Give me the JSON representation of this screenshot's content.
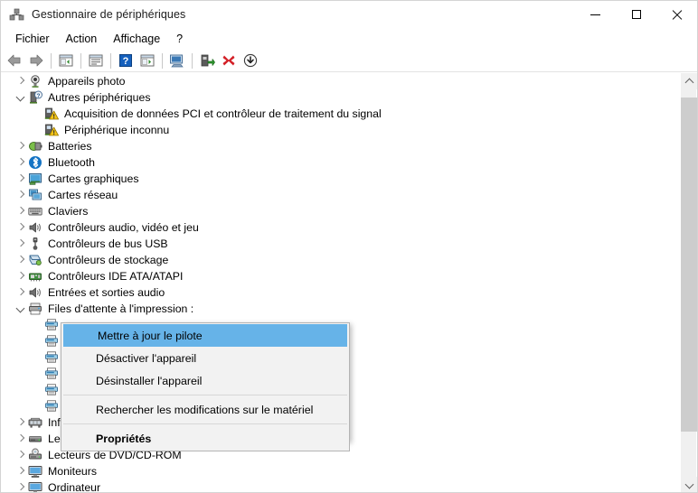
{
  "window": {
    "title": "Gestionnaire de périphériques",
    "icon": "device-manager-icon",
    "controls": {
      "minimize": "minimize-button",
      "maximize": "maximize-button",
      "close": "close-button"
    }
  },
  "menubar": {
    "items": [
      {
        "label": "Fichier",
        "name": "menu-fichier"
      },
      {
        "label": "Action",
        "name": "menu-action"
      },
      {
        "label": "Affichage",
        "name": "menu-affichage"
      },
      {
        "label": "?",
        "name": "menu-help"
      }
    ]
  },
  "toolbar": {
    "buttons": [
      {
        "name": "back-icon",
        "kind": "arrow-left"
      },
      {
        "name": "forward-icon",
        "kind": "arrow-right"
      },
      {
        "name": "separator",
        "kind": "sep"
      },
      {
        "name": "show-hide-console-tree-icon",
        "kind": "tree-pane"
      },
      {
        "name": "separator",
        "kind": "sep"
      },
      {
        "name": "properties-icon",
        "kind": "properties"
      },
      {
        "name": "separator",
        "kind": "sep"
      },
      {
        "name": "help-icon",
        "kind": "help"
      },
      {
        "name": "action-menu-icon",
        "kind": "action-pane"
      },
      {
        "name": "separator",
        "kind": "sep"
      },
      {
        "name": "scan-hardware-changes-icon",
        "kind": "scan"
      },
      {
        "name": "separator",
        "kind": "sep"
      },
      {
        "name": "update-driver-icon",
        "kind": "update-driver"
      },
      {
        "name": "uninstall-device-icon",
        "kind": "uninstall"
      },
      {
        "name": "disable-device-icon",
        "kind": "disable"
      }
    ]
  },
  "tree": {
    "rows": [
      {
        "label": "Appareils photo",
        "level": 1,
        "state": "collapsed",
        "icon": "camera-icon",
        "name": "tree-item-appareils-photo"
      },
      {
        "label": "Autres périphériques",
        "level": 1,
        "state": "expanded",
        "icon": "unknown-device-icon",
        "name": "tree-item-autres-peripheriques"
      },
      {
        "label": "Acquisition de données PCI et contrôleur de traitement du signal",
        "level": 2,
        "state": "none",
        "icon": "warning-device-icon",
        "name": "tree-item-acquisition-pci"
      },
      {
        "label": "Périphérique inconnu",
        "level": 2,
        "state": "none",
        "icon": "warning-device-icon",
        "name": "tree-item-peripherique-inconnu"
      },
      {
        "label": "Batteries",
        "level": 1,
        "state": "collapsed",
        "icon": "battery-icon",
        "name": "tree-item-batteries"
      },
      {
        "label": "Bluetooth",
        "level": 1,
        "state": "collapsed",
        "icon": "bluetooth-icon",
        "name": "tree-item-bluetooth"
      },
      {
        "label": "Cartes graphiques",
        "level": 1,
        "state": "collapsed",
        "icon": "display-adapter-icon",
        "name": "tree-item-cartes-graphiques"
      },
      {
        "label": "Cartes réseau",
        "level": 1,
        "state": "collapsed",
        "icon": "network-adapter-icon",
        "name": "tree-item-cartes-reseau"
      },
      {
        "label": "Claviers",
        "level": 1,
        "state": "collapsed",
        "icon": "keyboard-icon",
        "name": "tree-item-claviers"
      },
      {
        "label": "Contrôleurs audio, vidéo et jeu",
        "level": 1,
        "state": "collapsed",
        "icon": "speaker-icon",
        "name": "tree-item-controleurs-audio-video-jeu"
      },
      {
        "label": "Contrôleurs de bus USB",
        "level": 1,
        "state": "collapsed",
        "icon": "usb-icon",
        "name": "tree-item-controleurs-bus-usb"
      },
      {
        "label": "Contrôleurs de stockage",
        "level": 1,
        "state": "collapsed",
        "icon": "storage-controller-icon",
        "name": "tree-item-controleurs-stockage"
      },
      {
        "label": "Contrôleurs IDE ATA/ATAPI",
        "level": 1,
        "state": "collapsed",
        "icon": "ide-controller-icon",
        "name": "tree-item-controleurs-ide-ata-atapi"
      },
      {
        "label": "Entrées et sorties audio",
        "level": 1,
        "state": "collapsed",
        "icon": "speaker-icon",
        "name": "tree-item-entrees-sorties-audio"
      },
      {
        "label": "Files d'attente à l'impression :",
        "level": 1,
        "state": "expanded",
        "icon": "printer-queue-icon",
        "name": "tree-item-files-attente-impression"
      },
      {
        "label": "",
        "level": 2,
        "state": "none",
        "icon": "printer-icon",
        "name": "tree-item-printer-1"
      },
      {
        "label": "",
        "level": 2,
        "state": "none",
        "icon": "printer-icon",
        "name": "tree-item-printer-2"
      },
      {
        "label": "",
        "level": 2,
        "state": "none",
        "icon": "printer-icon",
        "name": "tree-item-printer-3"
      },
      {
        "label": "",
        "level": 2,
        "state": "none",
        "icon": "printer-icon",
        "name": "tree-item-printer-4"
      },
      {
        "label": "",
        "level": 2,
        "state": "none",
        "icon": "printer-icon",
        "name": "tree-item-printer-5"
      },
      {
        "label": "",
        "level": 2,
        "state": "none",
        "icon": "printer-icon",
        "name": "tree-item-printer-6"
      },
      {
        "label": "Inf",
        "level": 1,
        "state": "collapsed",
        "icon": "imaging-device-icon",
        "name": "tree-item-inf"
      },
      {
        "label": "Lecteurs de disque",
        "level": 1,
        "state": "collapsed",
        "icon": "disk-drive-icon",
        "name": "tree-item-lecteurs-de-disque"
      },
      {
        "label": "Lecteurs de DVD/CD-ROM",
        "level": 1,
        "state": "collapsed",
        "icon": "dvd-drive-icon",
        "name": "tree-item-lecteurs-dvd-cdrom"
      },
      {
        "label": "Moniteurs",
        "level": 1,
        "state": "collapsed",
        "icon": "monitor-icon",
        "name": "tree-item-moniteurs"
      },
      {
        "label": "Ordinateur",
        "level": 1,
        "state": "collapsed",
        "icon": "computer-icon",
        "name": "tree-item-ordinateur"
      }
    ]
  },
  "context_menu": {
    "items": [
      {
        "label": "Mettre à jour le pilote",
        "type": "item",
        "highlighted": true,
        "name": "ctx-update-driver"
      },
      {
        "label": "Désactiver l'appareil",
        "type": "item",
        "highlighted": false,
        "name": "ctx-disable-device"
      },
      {
        "label": "Désinstaller l'appareil",
        "type": "item",
        "highlighted": false,
        "name": "ctx-uninstall-device"
      },
      {
        "label": "",
        "type": "separator",
        "name": "ctx-separator-1"
      },
      {
        "label": "Rechercher les modifications sur le matériel",
        "type": "item",
        "highlighted": false,
        "name": "ctx-scan-hardware"
      },
      {
        "label": "",
        "type": "separator",
        "name": "ctx-separator-2"
      },
      {
        "label": "Propriétés",
        "type": "item",
        "highlighted": false,
        "bold": true,
        "name": "ctx-properties"
      }
    ]
  },
  "scrollbar": {
    "up_arrow": "scroll-up-arrow",
    "down_arrow": "scroll-down-arrow",
    "thumb": "scroll-thumb"
  },
  "colors": {
    "highlight": "#66b3e8",
    "menu_bg": "#f2f2f2",
    "scrollbar_thumb": "#cdcdcd",
    "warning": "#f5c518"
  }
}
